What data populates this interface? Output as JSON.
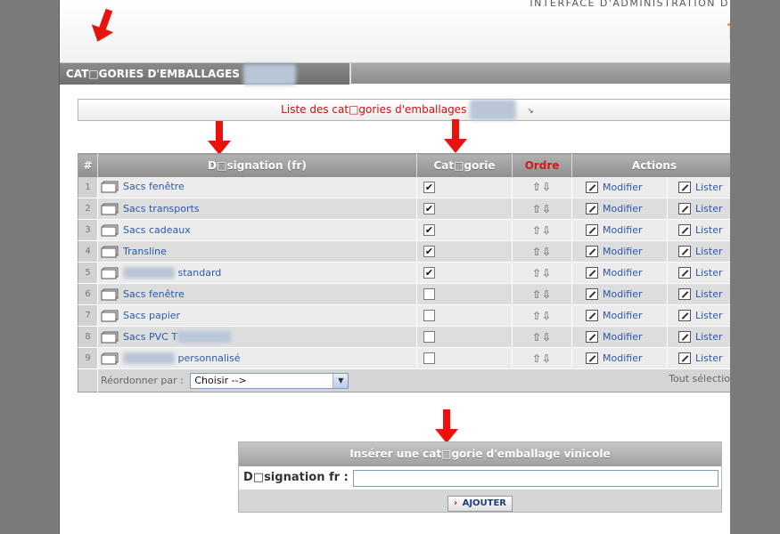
{
  "header": {
    "admin_title": "INTERFACE D'ADMINISTRATION D",
    "logo_fragment": "f"
  },
  "section": {
    "title": "CAT□GORIES D'EMBALLAGES",
    "title_suffix_blurred": "vinicoles"
  },
  "list_header": {
    "label": "Liste des cat□gories d'emballages",
    "label_suffix_blurred": "vinicoles",
    "ext_icon": "external-link-icon"
  },
  "table": {
    "headers": {
      "num": "#",
      "designation": "D□signation (fr)",
      "category": "Cat□gorie",
      "order": "Ordre",
      "actions": "Actions"
    },
    "rows": [
      {
        "num": "1",
        "prefix_blur": "",
        "label": "Sacs fenêtre",
        "checked": true
      },
      {
        "num": "2",
        "prefix_blur": "",
        "label": "Sacs transports",
        "checked": true
      },
      {
        "num": "3",
        "prefix_blur": "",
        "label": "Sacs cadeaux",
        "checked": true
      },
      {
        "num": "4",
        "prefix_blur": "",
        "label": "Transline",
        "checked": true
      },
      {
        "num": "5",
        "prefix_blur": "Emballage",
        "label": "standard",
        "checked": true
      },
      {
        "num": "6",
        "prefix_blur": "",
        "label": "Sacs fenêtre",
        "checked": false
      },
      {
        "num": "7",
        "prefix_blur": "",
        "label": "Sacs papier",
        "checked": false
      },
      {
        "num": "8",
        "prefix_blur": "",
        "label": "Sacs PVC T",
        "checked": false,
        "suffix_blur": "ransparent"
      },
      {
        "num": "9",
        "prefix_blur": "Emballage",
        "label": "personnalisé",
        "checked": false
      }
    ],
    "modify_label": "Modifier",
    "list_label": "Lister",
    "check_mark": "✔",
    "order_arrows": "⇧⇩",
    "footer": {
      "reorder_label": "Réordonner par :",
      "select_value": "Choisir -->",
      "select_all": "Tout sélection"
    }
  },
  "insert": {
    "title": "Insérer une cat□gorie d'emballage vinicole",
    "field_label": "D□signation fr :",
    "field_value": "",
    "button_label": "AJOUTER",
    "button_chevron": "›"
  },
  "colors": {
    "arrow": "#e8140c",
    "link": "#2a5aa8",
    "accent_red": "#cc1111"
  }
}
